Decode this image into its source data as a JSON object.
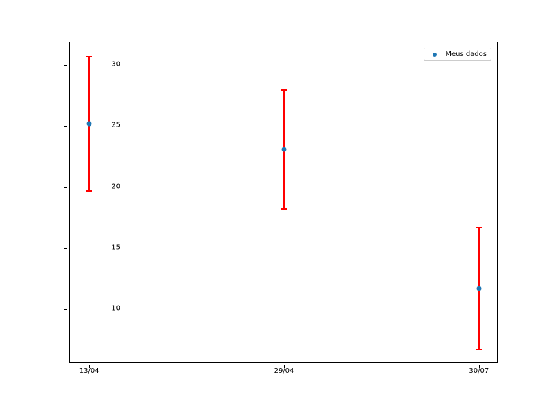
{
  "chart_data": {
    "type": "scatter",
    "categories": [
      "13/04",
      "29/04",
      "30/07"
    ],
    "series": [
      {
        "name": "Meus dados",
        "values": [
          25.2,
          23.1,
          11.7
        ],
        "yerr": [
          5.5,
          4.9,
          5.0
        ]
      }
    ],
    "title": "",
    "xlabel": "",
    "ylabel": "",
    "ylim": [
      5.5,
      31.9
    ],
    "xlim": [
      -0.1,
      2.1
    ],
    "yticks": [
      10,
      15,
      20,
      25,
      30
    ],
    "legend_loc": "upper right",
    "error_color": "#ff0000",
    "marker_color": "#1f77b4"
  },
  "legend": {
    "label": "Meus dados"
  },
  "yticks": {
    "t0": "10",
    "t1": "15",
    "t2": "20",
    "t3": "25",
    "t4": "30"
  },
  "xticks": {
    "t0": "13/04",
    "t1": "29/04",
    "t2": "30/07"
  }
}
